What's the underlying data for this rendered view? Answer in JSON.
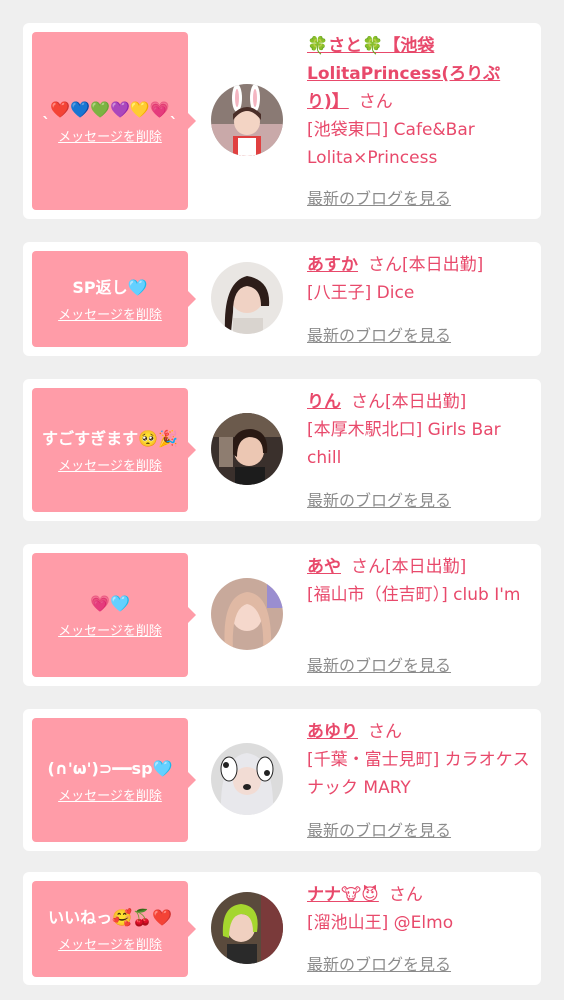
{
  "delete_label": "メッセージを削除",
  "blog_label": "最新のブログを見る",
  "san": "さん",
  "colors": {
    "bubble": "#ff9ca8",
    "accent": "#e8496b",
    "link_gray": "#8c8c8c",
    "page_bg": "#efefef"
  },
  "items": [
    {
      "message": "ˎ❤️💙💚💜💛💗ˎ",
      "name": "🍀さと🍀【池袋LolitaPrincess(ろりぷり)】",
      "status": "",
      "shop": "[池袋東口] Cafe&Bar Lolita×Princess",
      "avatar": "avatar-photo-bunny-ears"
    },
    {
      "message": "SP返し🩵",
      "name": "あすか",
      "status": "[本日出勤]",
      "shop": "[八王子] Dice",
      "avatar": "avatar-photo"
    },
    {
      "message": "すごすぎます🥺🎉",
      "name": "りん",
      "status": "[本日出勤]",
      "shop": "[本厚木駅北口] Girls Bar chill",
      "avatar": "avatar-photo"
    },
    {
      "message": "💗🩵",
      "name": "あや",
      "status": "[本日出勤]",
      "shop": "[福山市（住吉町）] club I'm",
      "avatar": "avatar-photo"
    },
    {
      "message": "(∩'ω')⊃━━sp🩵",
      "name": "あゆり",
      "status": "",
      "shop": "[千葉・富士見町] カラオケスナック MARY",
      "avatar": "avatar-photo-dog-filter"
    },
    {
      "message": "いいねっ🥰🍒❤️",
      "name": "ナナ🐮😈",
      "status": "",
      "shop": "[溜池山王] @Elmo",
      "avatar": "avatar-photo-green-hair"
    }
  ]
}
